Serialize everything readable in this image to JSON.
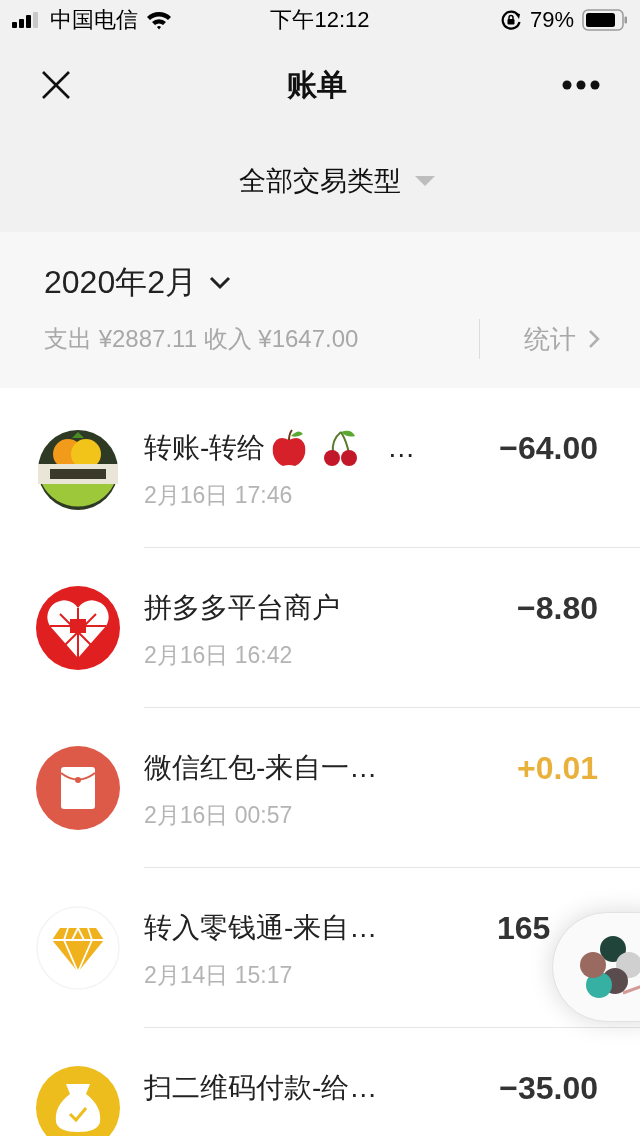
{
  "status_bar": {
    "carrier": "中国电信",
    "time": "下午12:12",
    "battery": "79%"
  },
  "nav": {
    "title": "账单"
  },
  "filter": {
    "label": "全部交易类型"
  },
  "summary": {
    "month": "2020年2月",
    "totals": "支出 ¥2887.11 收入 ¥1647.00",
    "stats": "统计"
  },
  "transactions": [
    {
      "kind": "fruit",
      "title": "转账-转给",
      "title_emoji": true,
      "ellipsis": "…",
      "date": "2月16日 17:46",
      "amount": "−64.00",
      "income": false
    },
    {
      "kind": "heart",
      "title": "拼多多平台商户",
      "date": "2月16日 16:42",
      "amount": "−8.80",
      "income": false
    },
    {
      "kind": "envelope",
      "title": "微信红包-来自一…",
      "date": "2月16日 00:57",
      "amount": "+0.01",
      "income": true
    },
    {
      "kind": "diamond",
      "title": "转入零钱通-来自…",
      "date": "2月14日 15:17",
      "amount": "165",
      "income": false,
      "covered": true
    },
    {
      "kind": "bag",
      "title": "扫二维码付款-给…",
      "amount": "−35.00",
      "income": false
    }
  ]
}
